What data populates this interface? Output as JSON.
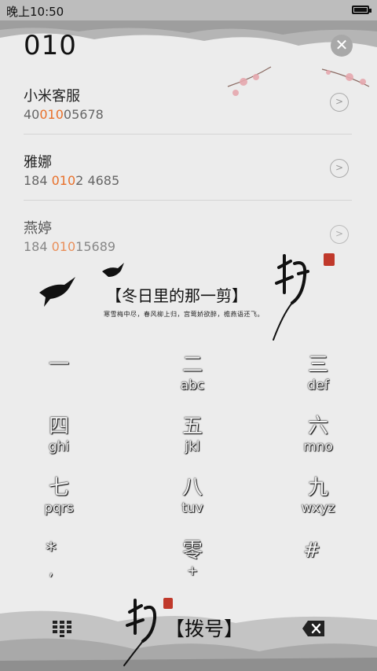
{
  "status_bar": {
    "time": "晚上10:50"
  },
  "dialer": {
    "input": "010",
    "clear_symbol": "✕"
  },
  "contacts": [
    {
      "name": "小米客服",
      "phone_pre": "40",
      "phone_match": "010",
      "phone_post": "05678"
    },
    {
      "name": "雅娜",
      "phone_pre": "184 ",
      "phone_match": "010",
      "phone_post": "2 4685"
    },
    {
      "name": "燕婷",
      "phone_pre": "184 ",
      "phone_match": "010",
      "phone_post": "15689"
    }
  ],
  "theme": {
    "title": "【冬日里的那一剪】",
    "subtitle": "寒雪梅中尽，春风柳上归，宫莺娇欲醉，檐燕语还飞。"
  },
  "keypad": [
    {
      "main": "一",
      "sub": ""
    },
    {
      "main": "二",
      "sub": "abc"
    },
    {
      "main": "三",
      "sub": "def"
    },
    {
      "main": "四",
      "sub": "ghi"
    },
    {
      "main": "五",
      "sub": "jkl"
    },
    {
      "main": "六",
      "sub": "mno"
    },
    {
      "main": "七",
      "sub": "pqrs"
    },
    {
      "main": "八",
      "sub": "tuv"
    },
    {
      "main": "九",
      "sub": "wxyz"
    },
    {
      "main": "*",
      "sub": ","
    },
    {
      "main": "零",
      "sub": "+"
    },
    {
      "main": "#",
      "sub": ""
    }
  ],
  "bottom": {
    "dial_label": "【拨号】"
  },
  "colors": {
    "match_highlight": "#e8702a",
    "accent_ink": "#111111"
  }
}
